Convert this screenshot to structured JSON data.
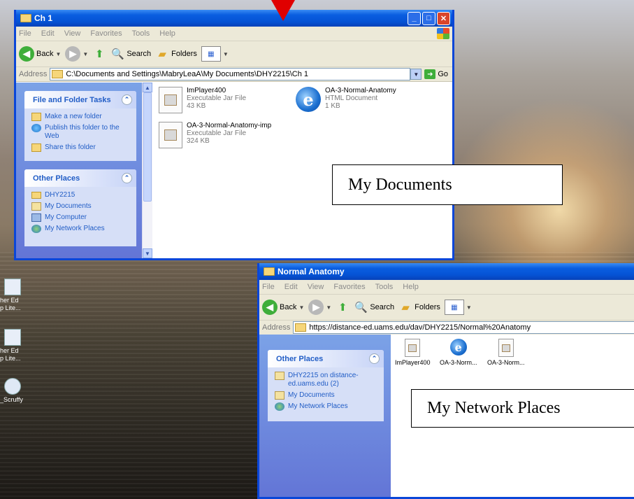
{
  "desktop": {
    "icons": [
      {
        "label": "her Ed\np Lite..."
      },
      {
        "label": "her Ed\np Lite..."
      },
      {
        "label": "_Scruffy"
      }
    ]
  },
  "window1": {
    "title": "Ch 1",
    "menu": [
      "File",
      "Edit",
      "View",
      "Favorites",
      "Tools",
      "Help"
    ],
    "toolbar": {
      "back": "Back",
      "search": "Search",
      "folders": "Folders"
    },
    "address_label": "Address",
    "address_value": "C:\\Documents and Settings\\MabryLeaA\\My Documents\\DHY2215\\Ch 1",
    "go_label": "Go",
    "panels": {
      "tasks": {
        "title": "File and Folder Tasks",
        "items": [
          "Make a new folder",
          "Publish this folder to the Web",
          "Share this folder"
        ]
      },
      "other": {
        "title": "Other Places",
        "items": [
          "DHY2215",
          "My Documents",
          "My Computer",
          "My Network Places"
        ]
      }
    },
    "files": [
      {
        "name": "ImPlayer400",
        "type": "Executable Jar File",
        "size": "43 KB"
      },
      {
        "name": "OA-3-Normal-Anatomy",
        "type": "HTML Document",
        "size": "1 KB"
      },
      {
        "name": "OA-3-Normal-Anatomy-imp",
        "type": "Executable Jar File",
        "size": "324 KB"
      }
    ]
  },
  "window2": {
    "title": "Normal Anatomy",
    "menu": [
      "File",
      "Edit",
      "View",
      "Favorites",
      "Tools",
      "Help"
    ],
    "toolbar": {
      "back": "Back",
      "search": "Search",
      "folders": "Folders"
    },
    "address_label": "Address",
    "address_value": "https://distance-ed.uams.edu/dav/DHY2215/Normal%20Anatomy",
    "panels": {
      "other": {
        "title": "Other Places",
        "items": [
          "DHY2215 on distance-ed.uams.edu (2)",
          "My Documents",
          "My Network Places"
        ]
      }
    },
    "files": [
      "ImPlayer400",
      "OA-3-Norm...",
      "OA-3-Norm..."
    ]
  },
  "callouts": {
    "documents": "My Documents",
    "network": "My Network Places"
  }
}
